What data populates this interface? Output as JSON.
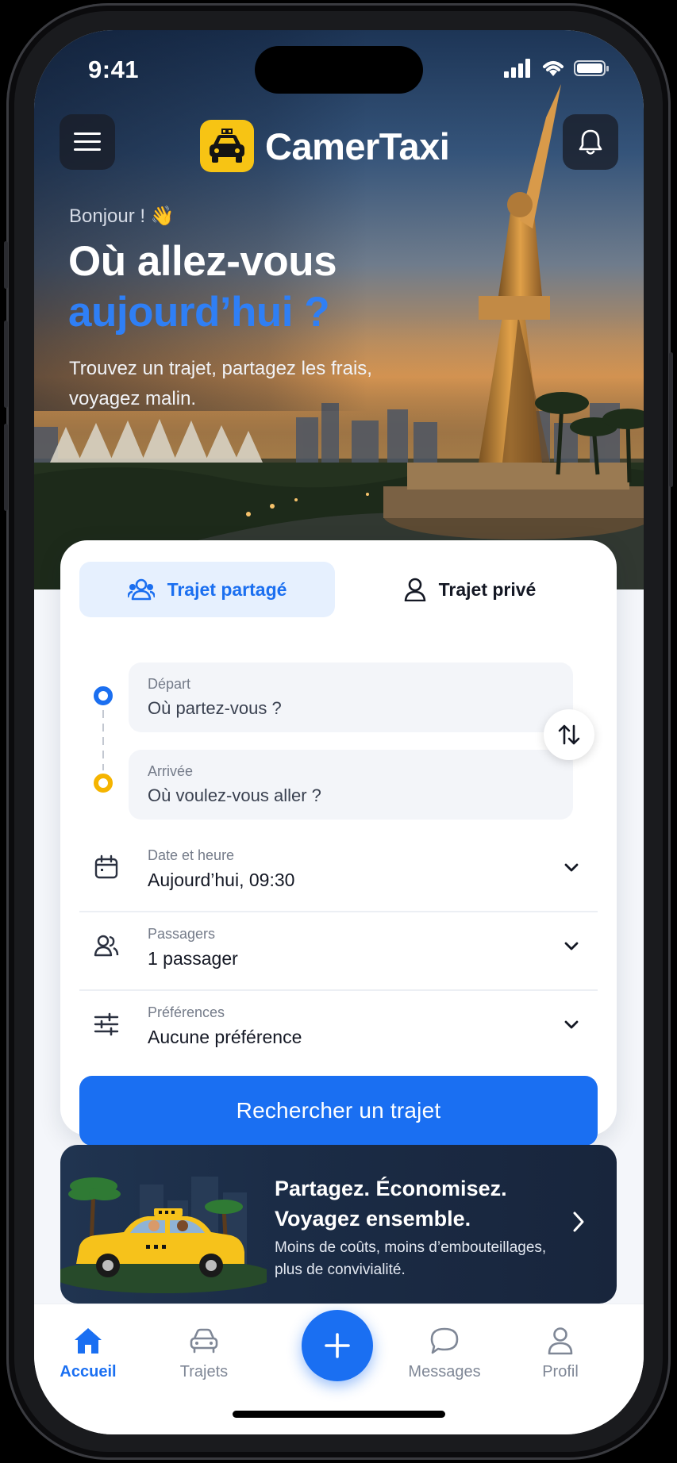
{
  "status_bar": {
    "time": "9:41"
  },
  "header": {
    "app_name": "CamerTaxi",
    "menu_icon": "hamburger-icon",
    "notification_icon": "bell-icon"
  },
  "hero": {
    "greeting": "Bonjour ! 👋",
    "title_line1": "Où allez-vous",
    "title_line2": "aujourd’hui ?",
    "subtitle": "Trouvez un trajet, partagez les frais, voyagez malin."
  },
  "search": {
    "tabs": [
      {
        "label": "Trajet partagé",
        "icon": "users-icon",
        "active": true
      },
      {
        "label": "Trajet privé",
        "icon": "user-icon",
        "active": false
      }
    ],
    "departure": {
      "label": "Départ",
      "placeholder": "Où partez-vous ?"
    },
    "arrival": {
      "label": "Arrivée",
      "placeholder": "Où voulez-vous aller ?"
    },
    "date": {
      "label": "Date et heure",
      "value": "Aujourd’hui, 09:30"
    },
    "passengers": {
      "label": "Passagers",
      "value": "1 passager"
    },
    "preferences": {
      "label": "Préférences",
      "value": "Aucune préférence"
    },
    "submit_label": "Rechercher un trajet"
  },
  "promo": {
    "title": "Partagez. Économisez. Voyagez ensemble.",
    "subtitle": "Moins de coûts, moins d’embouteillages, plus de convivialité."
  },
  "tabbar": {
    "items": [
      {
        "label": "Accueil",
        "icon": "home-icon",
        "active": true
      },
      {
        "label": "Trajets",
        "icon": "car-icon",
        "active": false
      },
      {
        "label": "Messages",
        "icon": "chat-icon",
        "active": false
      },
      {
        "label": "Profil",
        "icon": "profile-icon",
        "active": false
      }
    ],
    "fab_icon": "plus-icon"
  },
  "colors": {
    "accent": "#1a6ff2",
    "logo_yellow": "#f7c414",
    "departure_dot": "#1b6ff0",
    "arrival_dot": "#f5b400"
  }
}
